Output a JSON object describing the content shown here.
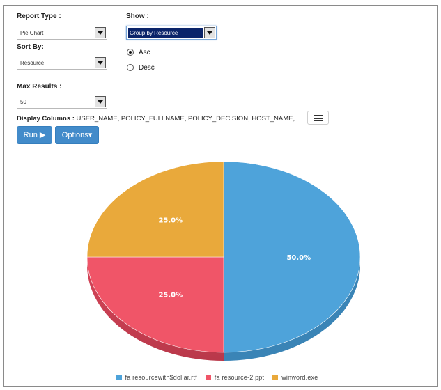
{
  "form": {
    "report_type_label": "Report Type :",
    "report_type_value": "Pie Chart",
    "show_label": "Show :",
    "show_value": "Group by Resource",
    "sort_by_label": "Sort By:",
    "sort_by_value": "Resource",
    "sort_order": {
      "asc": "Asc",
      "desc": "Desc",
      "selected": "Asc"
    },
    "max_results_label": "Max Results :",
    "max_results_value": "50",
    "display_columns_label": "Display Columns :",
    "display_columns_value": "USER_NAME, POLICY_FULLNAME, POLICY_DECISION, HOST_NAME, ..."
  },
  "buttons": {
    "run": "Run ▶",
    "options": "Options▾"
  },
  "chart_data": {
    "type": "pie",
    "slices": [
      {
        "label": "fa resourcewith$dollar.rtf",
        "value": 50.0,
        "display": "50.0%",
        "color": "#4ea3da"
      },
      {
        "label": "fa resource-2.ppt",
        "value": 25.0,
        "display": "25.0%",
        "color": "#f05568"
      },
      {
        "label": "winword.exe",
        "value": 25.0,
        "display": "25.0%",
        "color": "#e9a93b"
      }
    ],
    "legend_position": "bottom",
    "style": "3d"
  },
  "colors": {
    "primary_button": "#428bca",
    "select_highlight": "#0a246a"
  }
}
